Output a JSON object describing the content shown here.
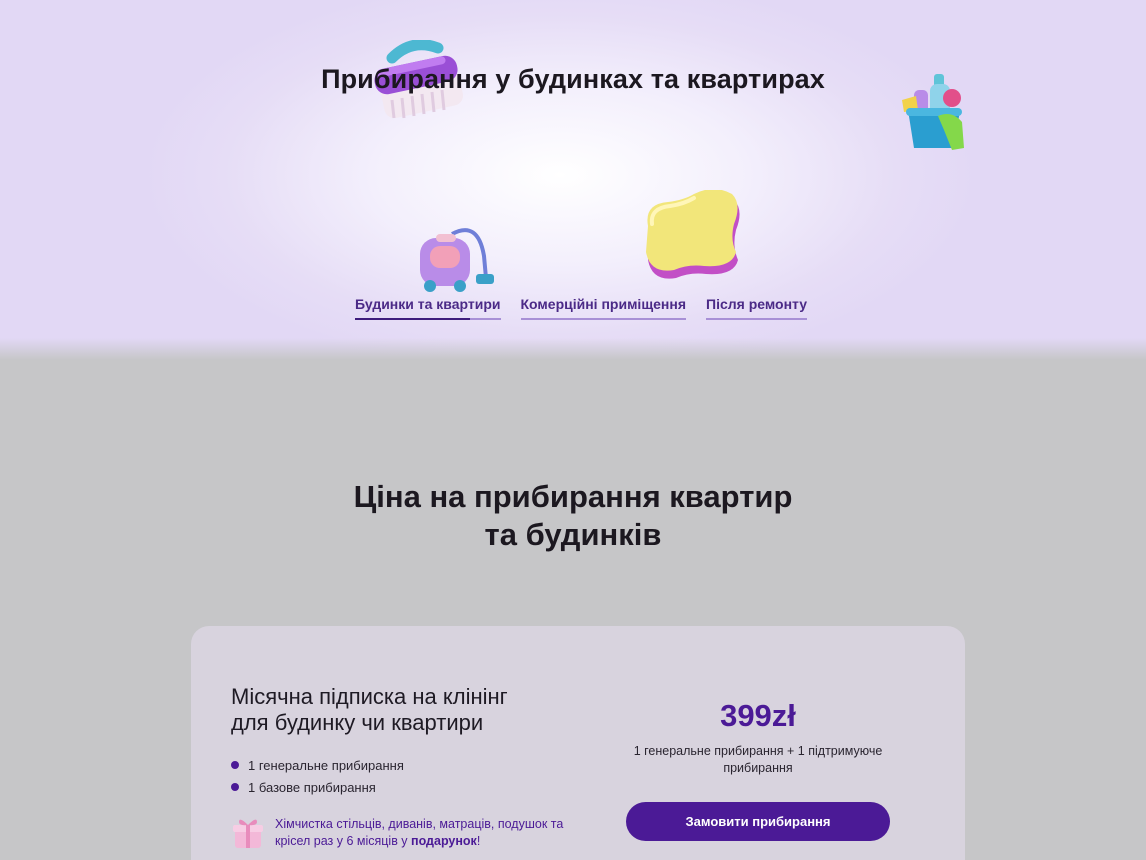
{
  "hero": {
    "title": "Прибирання у будинках та квартирах",
    "tabs": [
      {
        "label": "Будинки та квартири",
        "active": true,
        "progress": 0.79
      },
      {
        "label": "Комерційні приміщення",
        "active": false,
        "progress": 0
      },
      {
        "label": "Після ремонту",
        "active": false,
        "progress": 0
      }
    ],
    "illustrations": [
      "brush-icon",
      "cleaning-bucket-icon",
      "vacuum-cleaner-icon",
      "sponge-icon"
    ]
  },
  "pricing": {
    "title_line1": "Ціна на прибирання квартир",
    "title_line2": "та будинків",
    "card": {
      "title_line1": "Місячна підписка на клінінг",
      "title_line2": "для будинку чи квартири",
      "features": [
        "1 генеральне прибирання",
        "1 базове прибирання"
      ],
      "gift_text": "Хімчистка стільців, диванів, матраців, подушок та крісел раз у 6 місяців у ",
      "gift_bold": "подарунок",
      "gift_end": "!",
      "price": "399zł",
      "price_note": "1 генеральне прибирання + 1 підтримуюче прибирання",
      "button_label": "Замовити прибирання"
    }
  },
  "colors": {
    "accent": "#4b1a96",
    "tab_text": "#4b2a87",
    "card_bg": "#d8d3de",
    "page_bg": "#c6c6c8"
  }
}
